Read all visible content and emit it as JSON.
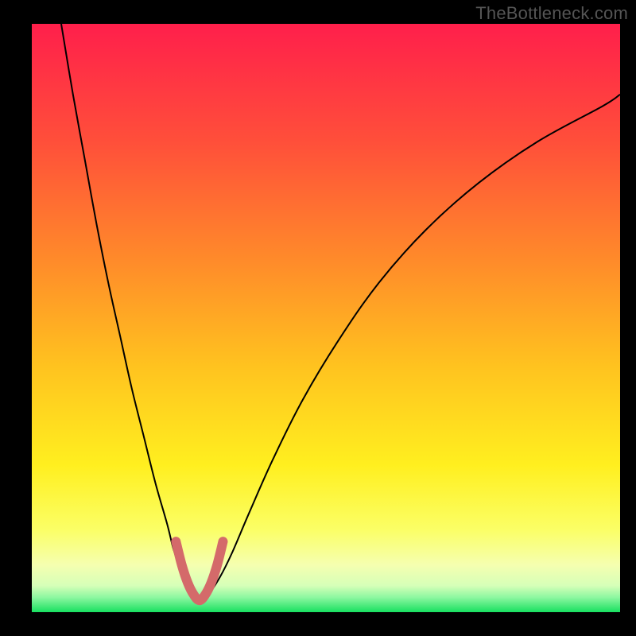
{
  "watermark": "TheBottleneck.com",
  "chart_data": {
    "type": "line",
    "title": "",
    "xlabel": "",
    "ylabel": "",
    "xlim": [
      0,
      100
    ],
    "ylim": [
      0,
      100
    ],
    "background_gradient": {
      "stops": [
        {
          "offset": 0,
          "color": "#ff1f4b"
        },
        {
          "offset": 0.2,
          "color": "#ff4f3a"
        },
        {
          "offset": 0.4,
          "color": "#ff8a2a"
        },
        {
          "offset": 0.58,
          "color": "#ffc21f"
        },
        {
          "offset": 0.75,
          "color": "#ffef1f"
        },
        {
          "offset": 0.86,
          "color": "#fbff66"
        },
        {
          "offset": 0.92,
          "color": "#f5ffb0"
        },
        {
          "offset": 0.955,
          "color": "#d6ffb8"
        },
        {
          "offset": 0.975,
          "color": "#8cf7a0"
        },
        {
          "offset": 1.0,
          "color": "#18e060"
        }
      ]
    },
    "series": [
      {
        "name": "bottleneck-curve",
        "stroke": "#000000",
        "stroke_width": 2,
        "x": [
          5,
          7,
          9,
          11,
          13,
          15,
          17,
          19,
          21,
          23,
          24,
          25,
          26,
          27,
          28.5,
          30,
          32,
          34,
          37,
          41,
          46,
          52,
          59,
          67,
          76,
          86,
          97,
          100
        ],
        "y": [
          100,
          88,
          77,
          66,
          56,
          47,
          38,
          30,
          22,
          15,
          11,
          8,
          5,
          3,
          2,
          3,
          6,
          10,
          17,
          26,
          36,
          46,
          56,
          65,
          73,
          80,
          86,
          88
        ]
      },
      {
        "name": "highlight-u",
        "stroke": "#d46a6a",
        "stroke_width": 12,
        "linecap": "round",
        "x": [
          24.5,
          25.5,
          26.5,
          27.5,
          28.5,
          29.5,
          30.5,
          31.5,
          32.5
        ],
        "y": [
          12,
          8,
          5,
          3,
          2,
          3,
          5,
          8,
          12
        ]
      }
    ]
  }
}
